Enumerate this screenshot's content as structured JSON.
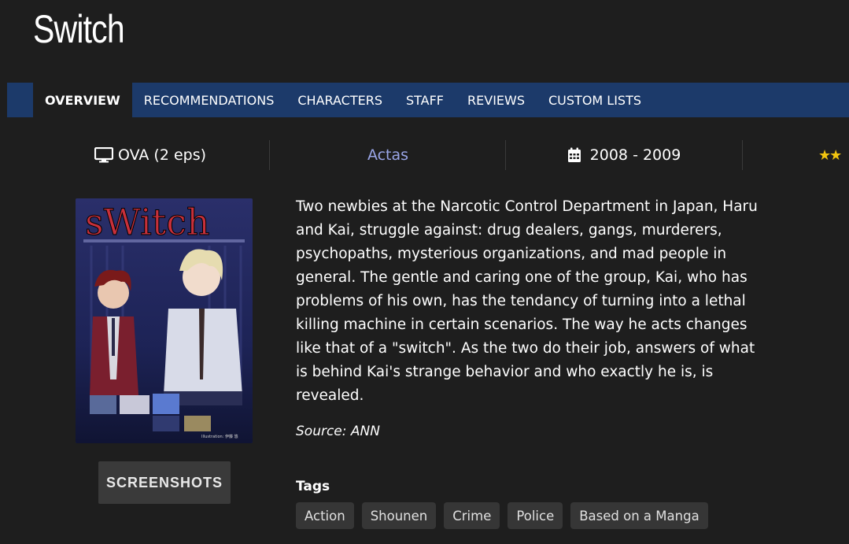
{
  "title": "Switch",
  "tabs": [
    {
      "label": "OVERVIEW",
      "active": true
    },
    {
      "label": "RECOMMENDATIONS"
    },
    {
      "label": "CHARACTERS"
    },
    {
      "label": "STAFF"
    },
    {
      "label": "REVIEWS"
    },
    {
      "label": "CUSTOM LISTS"
    }
  ],
  "info": {
    "type": "OVA (2 eps)",
    "type_icon": "monitor-icon",
    "studio": "Actas",
    "years": "2008 - 2009",
    "years_icon": "calendar-icon",
    "rating_icon": "star-icon"
  },
  "poster": {
    "title_text": "sWitch",
    "credit": "Illustration: 伊藤 悠"
  },
  "screenshots_button": "SCREENSHOTS",
  "synopsis": "Two newbies at the Narcotic Control Department in Japan, Haru and Kai, struggle against: drug dealers, gangs, murderers, psychopaths, mysterious organizations, and mad people in general. The gentle and caring one of the group, Kai, who has problems of his own, has the tendancy of turning into a lethal killing machine in certain scenarios. The way he acts changes like that of a \"switch\". As the two do their job, answers of what is behind Kai's strange behavior and who exactly he is, is revealed.",
  "source": "Source: ANN",
  "tags_label": "Tags",
  "tags": [
    "Action",
    "Shounen",
    "Crime",
    "Police",
    "Based on a Manga"
  ],
  "colors": {
    "background": "#1e1e1e",
    "tabbar": "#1c3a6a",
    "studio_link": "#9aa6e8",
    "star": "#f1c40f",
    "tag_bg": "#363636"
  }
}
